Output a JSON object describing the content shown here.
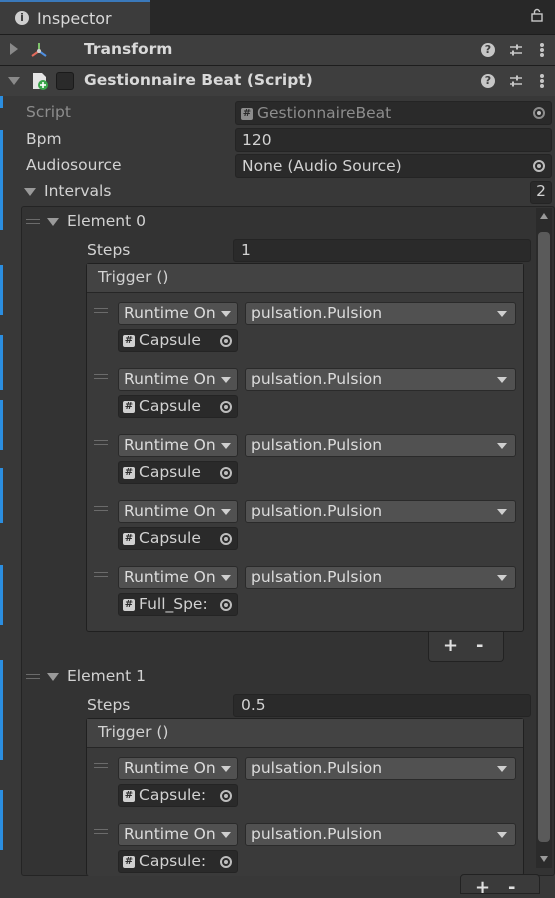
{
  "tab": {
    "title": "Inspector"
  },
  "components": [
    {
      "title": "Transform"
    },
    {
      "title": "Gestionnaire Beat (Script)"
    }
  ],
  "fields": {
    "script": {
      "label": "Script",
      "value": "GestionnaireBeat"
    },
    "bpm": {
      "label": "Bpm",
      "value": "120"
    },
    "audiosource": {
      "label": "Audiosource",
      "value": "None (Audio Source)"
    },
    "intervals": {
      "label": "Intervals",
      "count": "2"
    }
  },
  "elements": [
    {
      "label": "Element 0",
      "steps_label": "Steps",
      "steps": "1",
      "event_title": "Trigger ()",
      "listeners": [
        {
          "mode": "Runtime On",
          "function": "pulsation.Pulsion",
          "object": "Capsule"
        },
        {
          "mode": "Runtime On",
          "function": "pulsation.Pulsion",
          "object": "Capsule"
        },
        {
          "mode": "Runtime On",
          "function": "pulsation.Pulsion",
          "object": "Capsule"
        },
        {
          "mode": "Runtime On",
          "function": "pulsation.Pulsion",
          "object": "Capsule"
        },
        {
          "mode": "Runtime On",
          "function": "pulsation.Pulsion",
          "object": "Full_Spe:"
        }
      ]
    },
    {
      "label": "Element 1",
      "steps_label": "Steps",
      "steps": "0.5",
      "event_title": "Trigger ()",
      "listeners": [
        {
          "mode": "Runtime On",
          "function": "pulsation.Pulsion",
          "object": "Capsule:"
        },
        {
          "mode": "Runtime On",
          "function": "pulsation.Pulsion",
          "object": "Capsule:"
        }
      ]
    }
  ],
  "buttons": {
    "add": "+",
    "remove": "-"
  },
  "colors": {
    "accent": "#2b8ee0",
    "background": "#383838",
    "field": "#2a2a2a",
    "dropdown": "#515151"
  }
}
